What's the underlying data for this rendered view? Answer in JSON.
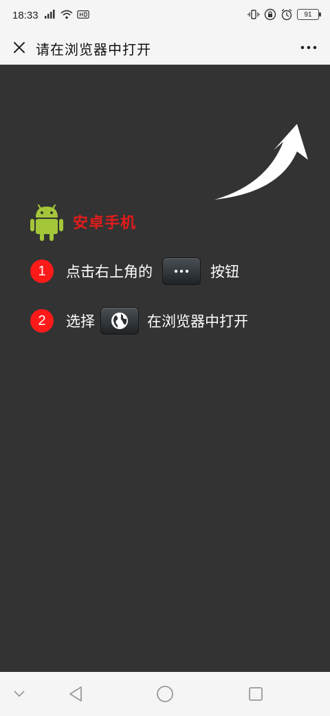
{
  "status_bar": {
    "time": "18:33",
    "battery": "91",
    "icons_left": [
      "signal-icon",
      "wifi-icon",
      "hd-icon"
    ],
    "icons_right": [
      "vibrate-icon",
      "lock-rotation-icon",
      "alarm-icon"
    ]
  },
  "title_bar": {
    "title": "请在浏览器中打开",
    "close_icon": "close-icon",
    "more_icon": "more-dots-icon"
  },
  "guide": {
    "android_label": "安卓手机",
    "step1": {
      "number": "1",
      "before": "点击右上角的",
      "after": "按钮"
    },
    "step2": {
      "number": "2",
      "before": "选择",
      "after": "在浏览器中打开"
    }
  },
  "colors": {
    "background": "#333333",
    "accent_red": "#ff1a1a",
    "android_green": "#a4c639",
    "label_red": "#e21b1b"
  },
  "nav_bar": {
    "items": [
      "chevron-down-icon",
      "back-icon",
      "home-icon",
      "recents-icon"
    ]
  }
}
